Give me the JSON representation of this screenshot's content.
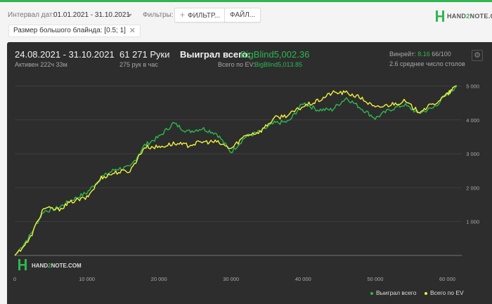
{
  "filterbar": {
    "date_label": "Интервал дат:",
    "date_value": "01.01.2021 - 31.10.2021",
    "filters_label": "Фильтры:",
    "filter_button": "ФИЛЬТР...",
    "file_button": "ФАЙЛ..."
  },
  "brand": {
    "logo_prefix": "HAND",
    "logo_two": "2",
    "logo_suffix": "NOTE.COM"
  },
  "chip": {
    "label": "Размер большого блайнда: [0.5; 1]",
    "close": "✕"
  },
  "stats": {
    "range": "24.08.2021 - 31.10.2021",
    "active": "Активен 222ч 33м",
    "hands": "61 271 Руки",
    "hands_per_hour": "275 рук в час",
    "won_label": "Выиграл всего:",
    "won_value": "BigBlind5,002.36",
    "ev_label": "Всего по EV:",
    "ev_value": "BigBlind5,013.85",
    "winrate_label": "Винрейт:",
    "winrate_value": "8.16",
    "winrate_unit": "66/100",
    "avg_tables": "2.6 среднее число столов"
  },
  "icons": {
    "settings": "gear-icon"
  },
  "colors": {
    "won": "#2db84f",
    "ev": "#f2f23d",
    "panel": "#2d2d2d"
  },
  "chart_data": {
    "type": "line",
    "title": "",
    "xlabel": "",
    "ylabel": "",
    "xlim": [
      0,
      62000
    ],
    "ylim": [
      -500,
      5300
    ],
    "x_ticks": [
      0,
      10000,
      20000,
      30000,
      40000,
      50000,
      60000
    ],
    "x_tick_labels": [
      "0",
      "10 000",
      "20 000",
      "30 000",
      "40 000",
      "50 000",
      "60 000"
    ],
    "y_ticks": [
      1000,
      2000,
      3000,
      4000,
      5000
    ],
    "y_tick_labels": [
      "1 000",
      "2 000",
      "3 000",
      "4 000",
      "5 000"
    ],
    "grid": true,
    "legend_position": "bottom-right",
    "x": [
      0,
      2000,
      4000,
      6000,
      8000,
      10000,
      12000,
      14000,
      16000,
      18000,
      20000,
      22000,
      24000,
      26000,
      28000,
      30000,
      32000,
      34000,
      36000,
      38000,
      40000,
      42000,
      44000,
      46000,
      48000,
      50000,
      52000,
      54000,
      56000,
      58000,
      60000,
      61271
    ],
    "series": [
      {
        "name": "Выиграл всего",
        "values": [
          0,
          550,
          1300,
          1400,
          1650,
          1850,
          2300,
          2550,
          2600,
          3250,
          3500,
          3900,
          3650,
          3750,
          3600,
          3050,
          3500,
          3650,
          3900,
          3950,
          4500,
          4300,
          4300,
          4650,
          4350,
          4050,
          4300,
          4450,
          4200,
          4350,
          4750,
          5002
        ]
      },
      {
        "name": "Всего по EV",
        "values": [
          0,
          450,
          1400,
          1350,
          1600,
          1700,
          2300,
          2450,
          2500,
          3200,
          3200,
          3300,
          3250,
          3350,
          3350,
          3150,
          3550,
          3650,
          4050,
          4150,
          4400,
          4550,
          4800,
          4800,
          4650,
          4350,
          4450,
          4550,
          4250,
          4450,
          4750,
          5014
        ]
      }
    ]
  },
  "legend": {
    "won": "Выиграл всего",
    "ev": "Всего по EV"
  }
}
